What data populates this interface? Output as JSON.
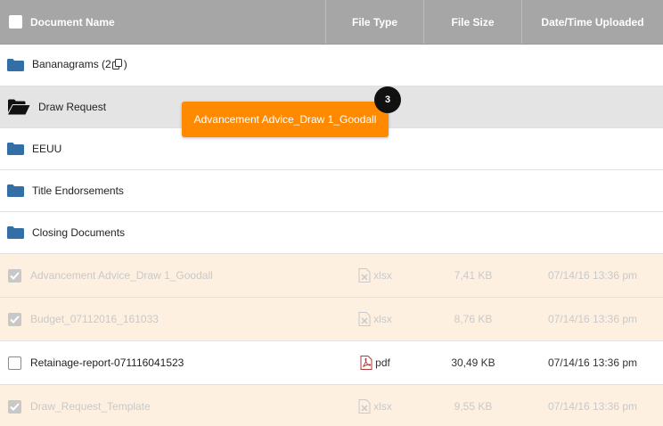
{
  "header": {
    "name": "Document Name",
    "type": "File Type",
    "size": "File Size",
    "date": "Date/Time Uploaded"
  },
  "folders": [
    {
      "name_prefix": "Bananagrams (2",
      "name_suffix": ")",
      "has_copy_icon": true
    },
    {
      "name": "Draw Request",
      "state": "open-selected"
    },
    {
      "name": "EEUU"
    },
    {
      "name": "Title Endorsements"
    },
    {
      "name": "Closing Documents"
    }
  ],
  "files": [
    {
      "name": "Advancement Advice_Draw 1_Goodall",
      "type": "xlsx",
      "size": "7,41 KB",
      "date": "07/14/16 13:36 pm",
      "checked": true
    },
    {
      "name": "Budget_07112016_161033",
      "type": "xlsx",
      "size": "8,76 KB",
      "date": "07/14/16 13:36 pm",
      "checked": true
    },
    {
      "name": "Retainage-report-071116041523",
      "type": "pdf",
      "size": "30,49 KB",
      "date": "07/14/16 13:36 pm",
      "checked": false
    },
    {
      "name": "Draw_Request_Template",
      "type": "xlsx",
      "size": "9,55 KB",
      "date": "07/14/16 13:36 pm",
      "checked": true
    }
  ],
  "drag": {
    "label": "Advancement Advice_Draw 1_Goodall",
    "count": "3"
  },
  "colors": {
    "header_bg": "#a6a6a6",
    "folder_blue": "#336ea6",
    "drag_orange": "#ff8a00",
    "checked_row": "#fdf0e0",
    "pdf_red": "#b03a3a"
  }
}
